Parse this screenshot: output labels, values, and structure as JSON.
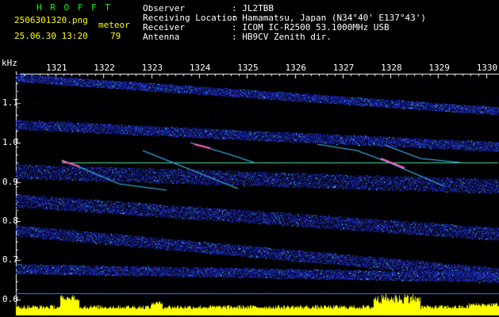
{
  "header": {
    "program": "H R O F F T",
    "filename": "2506301320.png",
    "mode": "meteor",
    "datetime": "25.06.30 13:20",
    "count": "79"
  },
  "station": {
    "observer_label": "Observer",
    "observer": ": JL2TBB",
    "location_label": "Receiving Location",
    "location": ": Hamamatsu, Japan (N34°40' E137°43')",
    "receiver_label": "Receiver",
    "receiver": ": ICOM IC-R2500 53.1000MHz USB",
    "antenna_label": "Antenna",
    "antenna": ": HB9CV Zenith dir."
  },
  "axes": {
    "y_unit": "kHz",
    "y_ticks": [
      "1.1",
      "1.0",
      "0.9",
      "0.8",
      "0.7",
      "0.6"
    ],
    "x_ticks": [
      "1321",
      "1322",
      "1323",
      "1324",
      "1325",
      "1326",
      "1327",
      "1328",
      "1329",
      "1330"
    ]
  },
  "colors": {
    "label_text": "#ffff00",
    "background": "#000000",
    "noise_band": "#2030c0",
    "marker_line": "#40e0a0",
    "histogram": "#ffff00"
  }
}
